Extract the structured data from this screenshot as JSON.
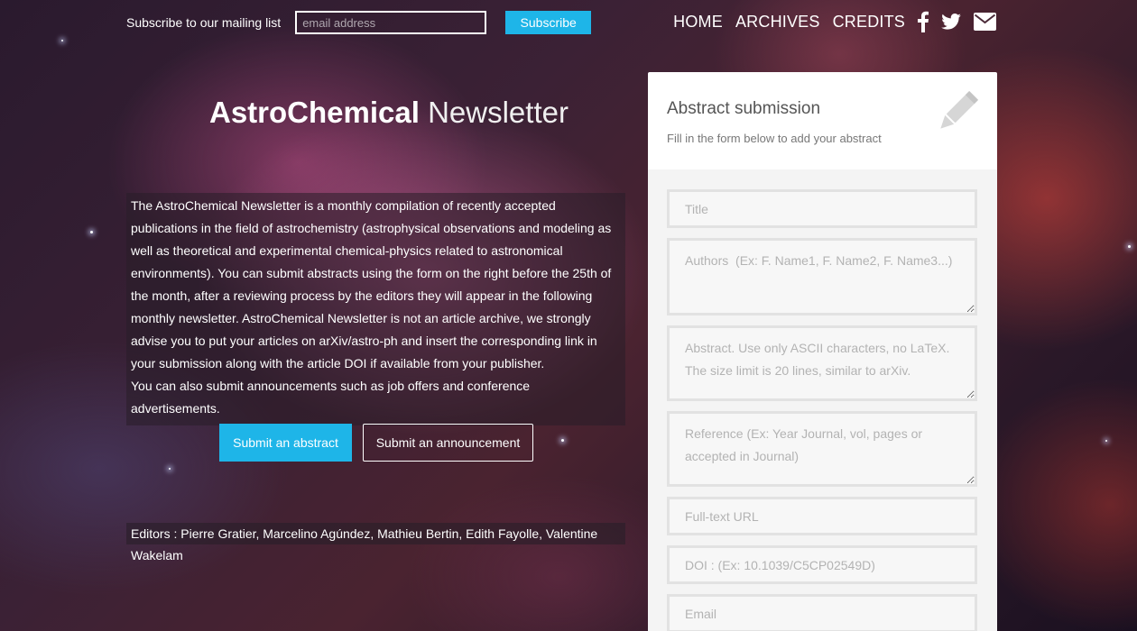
{
  "header": {
    "subscribe_label": "Subscribe to our mailing list",
    "email_placeholder": "email address",
    "subscribe_button": "Subscribe",
    "nav": {
      "home": "HOME",
      "archives": "ARCHIVES",
      "credits": "CREDITS"
    },
    "social_icons": [
      "facebook-icon",
      "twitter-icon",
      "envelope-icon"
    ]
  },
  "hero": {
    "title_bold": "AstroChemical",
    "title_light": "Newsletter",
    "intro": "The AstroChemical Newsletter is a monthly compilation of recently accepted publications in the field of astrochemistry (astrophysical observations and modeling as well as theoretical and experimental chemical-physics related to astronomical environments). You can submit abstracts using the form on the right before the 25th of the month, after a reviewing process by the editors they will appear in the following monthly newsletter. AstroChemical Newsletter is not an article archive, we strongly advise you to put your articles on arXiv/astro-ph and insert the corresponding link in your submission along with the article DOI if available from your publisher.",
    "intro_extra": "You can also submit announcements such as job offers and conference advertisements.",
    "submit_abstract_button": "Submit an abstract",
    "submit_announcement_button": "Submit an announcement",
    "editors": "Editors : Pierre Gratier, Marcelino Agúndez, Mathieu Bertin, Edith Fayolle, Valentine Wakelam"
  },
  "form": {
    "title": "Abstract submission",
    "subtitle": "Fill in the form below to add your abstract",
    "fields": {
      "title": "Title",
      "authors": "Authors  (Ex: F. Name1, F. Name2, F. Name3...)",
      "abstract": "Abstract. Use only ASCII characters, no LaTeX. The size limit is 20 lines, similar to arXiv.",
      "reference": "Reference (Ex: Year Journal, vol, pages or accepted in Journal)",
      "url": "Full-text URL",
      "doi": "DOI : (Ex: 10.1039/C5CP02549D)",
      "email": "Email"
    }
  },
  "colors": {
    "accent": "#1eb5e8",
    "panel_bg": "#f4f4f4",
    "field_border": "#e2e2e2"
  }
}
